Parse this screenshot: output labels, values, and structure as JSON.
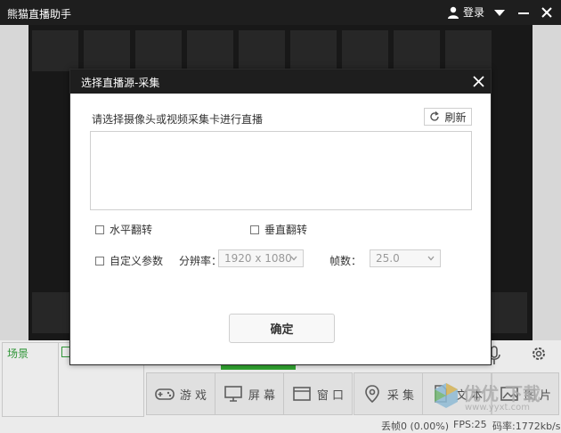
{
  "app": {
    "title": "熊猫直播助手",
    "login_label": "登录"
  },
  "dialog": {
    "title": "选择直播源-采集",
    "prompt": "请选择摄像头或视频采集卡进行直播",
    "refresh_label": "刷新",
    "flip_horizontal_label": "水平翻转",
    "flip_vertical_label": "垂直翻转",
    "custom_params_label": "自定义参数",
    "resolution_label": "分辨率：",
    "resolution_value": "1920 x 1080",
    "fps_label": "帧数：",
    "fps_value": "25.0",
    "ok_label": "确定"
  },
  "scene": {
    "label": "场景"
  },
  "sources": [
    {
      "label": "游 戏",
      "icon": "gamepad-icon"
    },
    {
      "label": "屏 幕",
      "icon": "monitor-icon"
    },
    {
      "label": "窗 口",
      "icon": "window-icon"
    },
    {
      "label": "采 集",
      "icon": "location-pin-icon"
    },
    {
      "label": "文 本",
      "icon": "document-icon"
    },
    {
      "label": "图 片",
      "icon": "picture-icon"
    }
  ],
  "status": {
    "dropped_frames": "丢帧0 (0.00%)",
    "fps": "FPS:25",
    "bitrate": "码率:1772kb/s"
  },
  "watermark": {
    "text": "优优 下载",
    "url": "www.yyxt.com"
  },
  "colors": {
    "accent": "#36b336",
    "titlebar": "#1e1e1e"
  }
}
